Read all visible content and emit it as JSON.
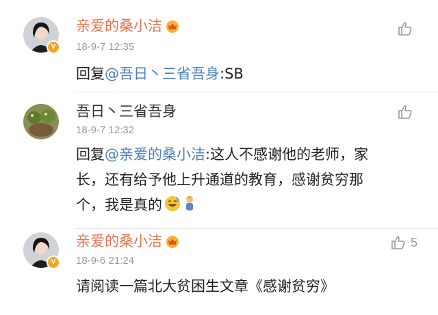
{
  "comments": [
    {
      "username": "亲爱的桑小洁",
      "time": "18-9-7 12:35",
      "reply_prefix": "回复",
      "mention": "@吾日丶三省吾身",
      "text": ":SB",
      "likes": ""
    },
    {
      "username": "吾日丶三省吾身",
      "time": "18-9-7 12:32",
      "reply_prefix": "回复",
      "mention": "@亲爱的桑小洁",
      "text_line1": ":这人不感谢他的老师，家",
      "text_line2": "长，还有给予他上升通道的教育，感谢贫穷那",
      "text_line3": "个，我是真的",
      "likes": ""
    },
    {
      "username": "亲爱的桑小洁",
      "time": "18-9-6 21:24",
      "text": "请阅读一篇北大贫困生文章《感谢贫穷》",
      "likes": "5"
    }
  ],
  "colors": {
    "vip_name": "#eb7350",
    "mention": "#4a7fc1",
    "meta": "#999999",
    "badge": "#f5a623"
  },
  "icons": {
    "like": "thumbs-up-icon",
    "crown": "vip-crown-icon",
    "verified": "verified-badge-icon"
  }
}
